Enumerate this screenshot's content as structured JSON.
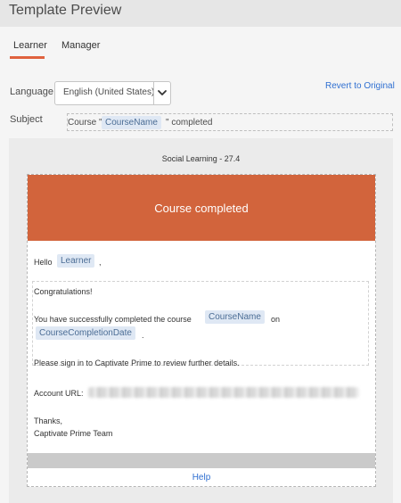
{
  "header": {
    "title": "Template Preview"
  },
  "tabs": [
    {
      "label": "Learner",
      "active": true
    },
    {
      "label": "Manager",
      "active": false
    }
  ],
  "form": {
    "language_label": "Language",
    "language_value": "English (United States)",
    "revert_link": "Revert to Original",
    "subject_label": "Subject",
    "subject_prefix": "Course \"",
    "subject_token": "CourseName",
    "subject_suffix": "\" completed"
  },
  "preview": {
    "caption": "Social Learning - 27.4",
    "banner_title": "Course completed",
    "hello": "Hello",
    "learner_token": "Learner",
    "hello_comma": ",",
    "congratulations": "Congratulations!",
    "success_text": "You have successfully completed the course",
    "course_token": "CourseName",
    "on_text": "on",
    "date_token": "CourseCompletionDate",
    "period": ".",
    "signin_text": "Please sign in to Captivate Prime to review further details.",
    "account_url_label": "Account URL:",
    "thanks": "Thanks,",
    "team": "Captivate Prime Team",
    "help_link": "Help"
  },
  "colors": {
    "accent": "#e0623e",
    "banner": "#d2643c",
    "link": "#2f6fd1",
    "token_bg": "#dfe8f4"
  },
  "icons": {
    "dropdown": "chevron-down-icon"
  }
}
